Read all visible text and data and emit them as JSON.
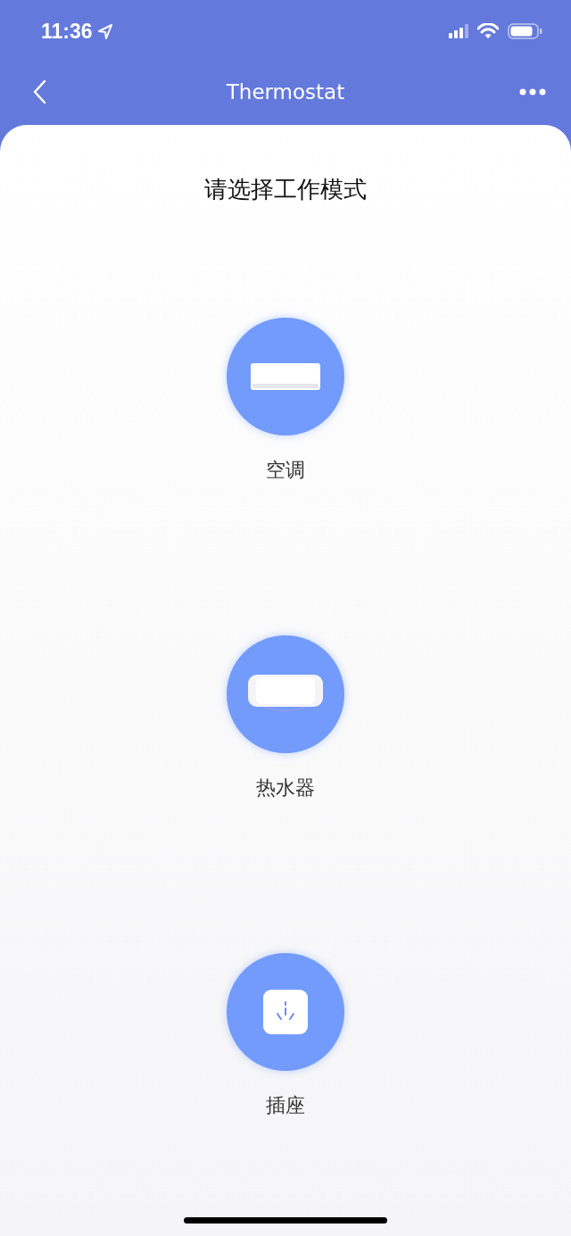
{
  "status_bar": {
    "time": "11:36"
  },
  "nav_bar": {
    "title": "Thermostat"
  },
  "heading": "请选择工作模式",
  "modes": [
    {
      "kind": "ac",
      "label": "空调"
    },
    {
      "kind": "heater",
      "label": "热水器"
    },
    {
      "kind": "socket",
      "label": "插座"
    }
  ]
}
